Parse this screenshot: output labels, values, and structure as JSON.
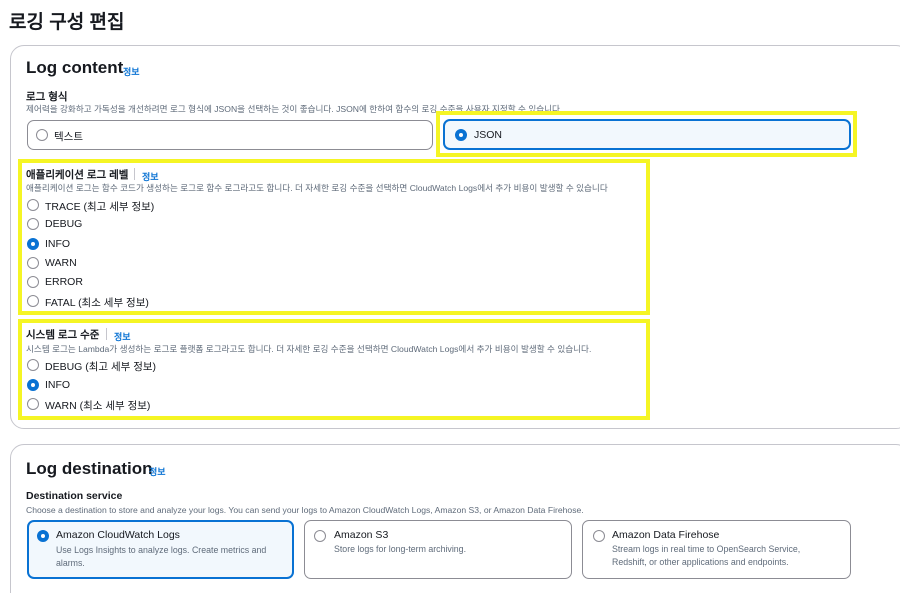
{
  "page": {
    "title": "로깅 구성 편집"
  },
  "log_content": {
    "title": "Log content",
    "info": "정보",
    "format": {
      "label": "로그 형식",
      "description": "제어력을 강화하고 가독성을 개선하려면 로그 형식에 JSON을 선택하는 것이 좋습니다. JSON에 한하여 함수의 로깅 수준을 사용자 지정할 수 있습니다",
      "options": [
        "텍스트",
        "JSON"
      ],
      "selected": "JSON"
    },
    "app_level": {
      "label": "애플리케이션 로그 레벨",
      "info": "정보",
      "description": "애플리케이션 로그는 함수 코드가 생성하는 로그로 함수 로그라고도 합니다. 더 자세한 로깅 수준을 선택하면 CloudWatch Logs에서 추가 비용이 발생할 수 있습니다",
      "options": [
        "TRACE (최고 세부 정보)",
        "DEBUG",
        "INFO",
        "WARN",
        "ERROR",
        "FATAL (최소 세부 정보)"
      ],
      "selected": "INFO"
    },
    "system_level": {
      "label": "시스템 로그 수준",
      "info": "정보",
      "description": "시스템 로그는 Lambda가 생성하는 로그로 플랫폼 로그라고도 합니다. 더 자세한 로깅 수준을 선택하면 CloudWatch Logs에서 추가 비용이 발생할 수 있습니다.",
      "options": [
        "DEBUG (최고 세부 정보)",
        "INFO",
        "WARN (최소 세부 정보)"
      ],
      "selected": "INFO"
    }
  },
  "log_destination": {
    "title": "Log destination",
    "info": "정보",
    "service": {
      "label": "Destination service",
      "description": "Choose a destination to store and analyze your logs. You can send your logs to Amazon CloudWatch Logs, Amazon S3, or Amazon Data Firehose.",
      "options": [
        {
          "title": "Amazon CloudWatch Logs",
          "description": "Use Logs Insights to analyze logs. Create metrics and alarms."
        },
        {
          "title": "Amazon S3",
          "description": "Store logs for long-term archiving."
        },
        {
          "title": "Amazon Data Firehose",
          "description": "Stream logs in real time to OpenSearch Service, Redshift, or other applications and endpoints."
        }
      ],
      "selected": "Amazon CloudWatch Logs"
    }
  },
  "colors": {
    "accent": "#0972d3",
    "highlight": "#f5f524",
    "text": "#16191f",
    "muted": "#5f6b7a",
    "border": "#8c8c94"
  }
}
